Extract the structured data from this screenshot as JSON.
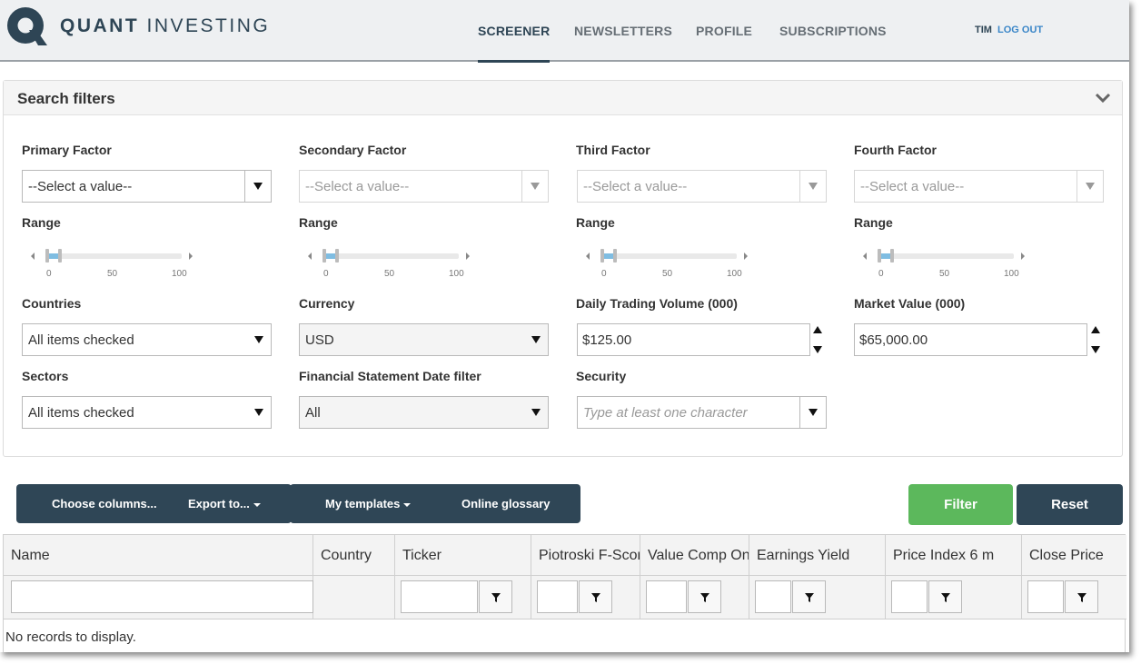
{
  "header": {
    "logo": {
      "word1": "QUANT",
      "word2": "INVESTING"
    },
    "nav": [
      {
        "label": "SCREENER",
        "active": true
      },
      {
        "label": "NEWSLETTERS",
        "active": false
      },
      {
        "label": "PROFILE",
        "active": false
      },
      {
        "label": "SUBSCRIPTIONS",
        "active": false
      }
    ],
    "user": {
      "name": "TIM",
      "logout": "LOG OUT"
    }
  },
  "filters": {
    "title": "Search filters",
    "factors": [
      {
        "label": "Primary Factor",
        "value": "--Select a value--",
        "range_label": "Range",
        "enabled": true
      },
      {
        "label": "Secondary Factor",
        "value": "--Select a value--",
        "range_label": "Range",
        "enabled": false
      },
      {
        "label": "Third Factor",
        "value": "--Select a value--",
        "range_label": "Range",
        "enabled": false
      },
      {
        "label": "Fourth Factor",
        "value": "--Select a value--",
        "range_label": "Range",
        "enabled": false
      }
    ],
    "range_ticks": [
      "0",
      "50",
      "100"
    ],
    "countries": {
      "label": "Countries",
      "value": "All items checked"
    },
    "currency": {
      "label": "Currency",
      "value": "USD"
    },
    "daily_volume": {
      "label": "Daily Trading Volume (000)",
      "value": "$125.00"
    },
    "market_value": {
      "label": "Market Value (000)",
      "value": "$65,000.00"
    },
    "sectors": {
      "label": "Sectors",
      "value": "All items checked"
    },
    "statement_date": {
      "label": "Financial Statement Date filter",
      "value": "All"
    },
    "security": {
      "label": "Security",
      "placeholder": "Type at least one character"
    }
  },
  "toolbar": {
    "choose_columns": "Choose columns...",
    "export_to": "Export to...",
    "my_templates": "My templates",
    "online_glossary": "Online glossary",
    "filter": "Filter",
    "reset": "Reset"
  },
  "grid": {
    "columns": [
      "Name",
      "Country",
      "Ticker",
      "Piotroski F-Score",
      "Value Comp One",
      "Earnings Yield",
      "Price Index 6 m",
      "Close Price"
    ],
    "empty_message": "No records to display."
  },
  "colors": {
    "brand_dark": "#2f4656",
    "filter_green": "#5cb85c",
    "link_blue": "#3a86c8",
    "slider_fill": "#7fbde2"
  }
}
